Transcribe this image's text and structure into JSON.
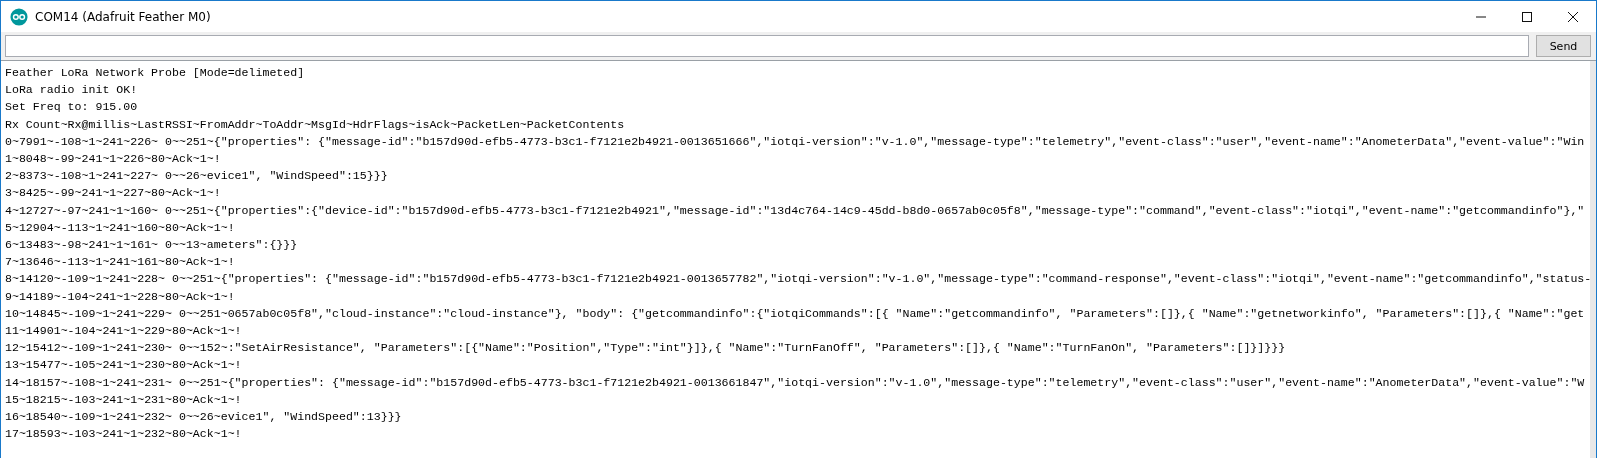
{
  "window": {
    "title": "COM14 (Adafruit Feather M0)"
  },
  "send_bar": {
    "button": "Send"
  },
  "console_lines": [
    "Feather LoRa Network Probe [Mode=delimeted]",
    "LoRa radio init OK!",
    "Set Freq to: 915.00",
    "Rx Count~Rx@millis~LastRSSI~FromAddr~ToAddr~MsgId~HdrFlags~isAck~PacketLen~PacketContents",
    "0~7991~-108~1~241~226~ 0~~251~{\"properties\": {\"message-id\":\"b157d90d-efb5-4773-b3c1-f7121e2b4921-0013651666\",\"iotqi-version\":\"v-1.0\",\"message-type\":\"telemetry\",\"event-class\":\"user\",\"event-name\":\"AnometerData\",\"event-value\":\"Win",
    "1~8048~-99~241~1~226~80~Ack~1~!",
    "2~8373~-108~1~241~227~ 0~~26~evice1\", \"WindSpeed\":15}}}",
    "3~8425~-99~241~1~227~80~Ack~1~!",
    "4~12727~-97~241~1~160~ 0~~251~{\"properties\":{\"device-id\":\"b157d90d-efb5-4773-b3c1-f7121e2b4921\",\"message-id\":\"13d4c764-14c9-45dd-b8d0-0657ab0c05f8\",\"message-type\":\"command\",\"event-class\":\"iotqi\",\"event-name\":\"getcommandinfo\"},\"",
    "5~12904~-113~1~241~160~80~Ack~1~!",
    "6~13483~-98~241~1~161~ 0~~13~ameters\":{}}}",
    "7~13646~-113~1~241~161~80~Ack~1~!",
    "8~14120~-109~1~241~228~ 0~~251~{\"properties\": {\"message-id\":\"b157d90d-efb5-4773-b3c1-f7121e2b4921-0013657782\",\"iotqi-version\":\"v-1.0\",\"message-type\":\"command-response\",\"event-class\":\"iotqi\",\"event-name\":\"getcommandinfo\",\"status-",
    "9~14189~-104~241~1~228~80~Ack~1~!",
    "10~14845~-109~1~241~229~ 0~~251~0657ab0c05f8\",\"cloud-instance\":\"cloud-instance\"}, \"body\": {\"getcommandinfo\":{\"iotqiCommands\":[{ \"Name\":\"getcommandinfo\", \"Parameters\":[]},{ \"Name\":\"getnetworkinfo\", \"Parameters\":[]},{ \"Name\":\"get",
    "11~14901~-104~241~1~229~80~Ack~1~!",
    "12~15412~-109~1~241~230~ 0~~152~:\"SetAirResistance\", \"Parameters\":[{\"Name\":\"Position\",\"Type\":\"int\"}]},{ \"Name\":\"TurnFanOff\", \"Parameters\":[]},{ \"Name\":\"TurnFanOn\", \"Parameters\":[]}]}}}",
    "13~15477~-105~241~1~230~80~Ack~1~!",
    "14~18157~-108~1~241~231~ 0~~251~{\"properties\": {\"message-id\":\"b157d90d-efb5-4773-b3c1-f7121e2b4921-0013661847\",\"iotqi-version\":\"v-1.0\",\"message-type\":\"telemetry\",\"event-class\":\"user\",\"event-name\":\"AnometerData\",\"event-value\":\"W",
    "15~18215~-103~241~1~231~80~Ack~1~!",
    "16~18540~-109~1~241~232~ 0~~26~evice1\", \"WindSpeed\":13}}}",
    "17~18593~-103~241~1~232~80~Ack~1~!"
  ]
}
